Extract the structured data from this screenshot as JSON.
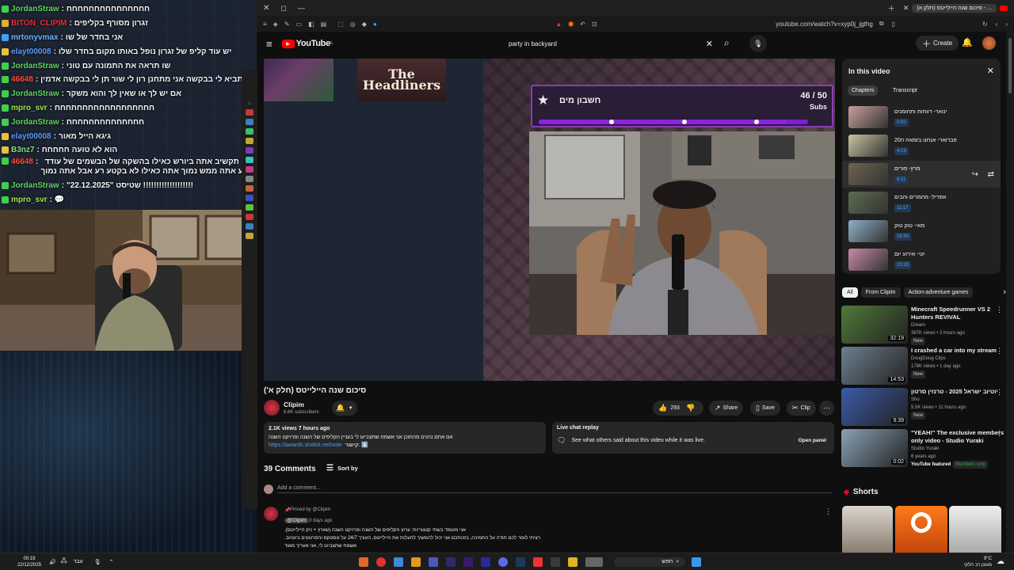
{
  "chat": {
    "messages": [
      {
        "user": "JordanStraw",
        "color": "#5fd35f",
        "badge": "#3fd14a",
        "text": "חחחחחחחחחחחחחחח"
      },
      {
        "user": "BITON_CLIPIM",
        "color": "#e0313a",
        "badge": "#e0b030",
        "text": "זגרון מסורף בקליפים"
      },
      {
        "user": "mrtonyvmax",
        "color": "#6ab6ff",
        "badge": "#3fa0ff",
        "text": "אני בחדר של שו"
      },
      {
        "user": "elayt00008",
        "color": "#5a9bff",
        "badge": "#e8c33a",
        "text": "יש עוד קליפ של זגרון נופל באותו מקום בחדר שלו"
      },
      {
        "user": "JordanStraw",
        "color": "#5fd35f",
        "badge": "#3fd14a",
        "text": "שו תראה את התמונה עם טוני"
      },
      {
        "user": "46648",
        "color": "#ff4c3b",
        "badge": "#3fd14a",
        "text": "שואו תביא לי בבקשה אני מתחנן רון לי שור תן לי בבקשה אדמין"
      },
      {
        "user": "JordanStraw",
        "color": "#5fd35f",
        "badge": "#3fd14a",
        "text": "אם יש לך או שאין לך והוא משקר"
      },
      {
        "user": "mpro_svr",
        "color": "#a0e34a",
        "badge": "#3fd14a",
        "text": "חחחחחחחחחחחחחחחחחח"
      },
      {
        "user": "JordanStraw",
        "color": "#5fd35f",
        "badge": "#3fd14a",
        "text": "חחחחחחחחחחחחחח"
      },
      {
        "user": "elayt00008",
        "color": "#5a9bff",
        "badge": "#e8c33a",
        "text": "גיגא הייל מאור"
      },
      {
        "user": "B3nz7",
        "color": "#7fe07f",
        "badge": "#e8c33a",
        "text": "הוא לא טועה חחחחח"
      },
      {
        "user": "46648",
        "color": "#ff4c3b",
        "badge": "#3fd14a",
        "text": "שוב תקשיב אתה ביורש כאילו בהשקה של הבשמים של עודד שמע אתה ממש נמוך אתה כאילו לא בקטע רע אבל אתה נמוך"
      },
      {
        "user": "JordanStraw",
        "color": "#5fd35f",
        "badge": "#3fd14a",
        "text": "\"22.12.2025\" שטיסט !!!!!!!!!!!!!!!!!!!"
      },
      {
        "user": "mpro_svr",
        "color": "#a0e34a",
        "badge": "#3fd14a",
        "text": "💬"
      }
    ]
  },
  "browser": {
    "url": "youtube.com/watch?v=xyp0j_jgthg",
    "tab_title": "סיכום שנה היילייטס (חלק א) - ..."
  },
  "youtube": {
    "logo": "YouTube",
    "country": "IL",
    "search_value": "party in backyard",
    "create_label": "Create",
    "video": {
      "overlay_title": "The Headliners",
      "goal_label": "חשבון מים",
      "goal_count": "46 / 50",
      "goal_unit": "Subs",
      "goal_progress": 0.92,
      "title": "סיכום שנה היילייטס (חלק א')"
    },
    "channel": {
      "name": "Clipim",
      "subs": "6.6K subscribers"
    },
    "actions": {
      "likes": "293",
      "share": "Share",
      "save": "Save",
      "clip": "Clip"
    },
    "description": {
      "meta": "2.1K views  7 hours ago",
      "line1": "אם אתם נהנים מהתוכן אני אשמח שתצביעו לי בעניין הקליפים של השנה ופרויקט השנה",
      "link": "https://awards.shotist.net/vote",
      "link_suffix": "קישור: ⬇️"
    },
    "live_chat": {
      "title": "Live chat replay",
      "text": "See what others said about this video while it was live.",
      "button": "Open panel"
    },
    "comments": {
      "count_label": "39 Comments",
      "sort_label": "Sort by",
      "placeholder": "Add a comment...",
      "pinned_label": "Pinned by @Clipim",
      "author": "@Clipim",
      "time": "3 days ago",
      "lines": [
        "אני מעומד בשתי קטגוריות: ערוץ הקליפים של השנה ופרויקט השנה (שוורץ + ניק היילייטס).",
        "רציתי לומר לכם תודה על התמיכה, בזכותכם אני יכול להמשיך להעלות את היילייטס, העורך 24/7 על טסטקס והסרטונים ביוטיוב.",
        "אשמח שתצביעו לי, אני אעריך מאוד"
      ]
    },
    "in_this_video": {
      "title": "In this video",
      "tabs": [
        "Chapters",
        "Transcript"
      ],
      "chapters": [
        {
          "title": "ינואר- דווחות ותהומנים",
          "time": "0:00",
          "color": "#c7a09b"
        },
        {
          "title": "פברואר- אנחנו בזמאה ה20",
          "time": "4:19",
          "color": "#c9c3a1"
        },
        {
          "title": "מרץ- פורים",
          "time": "8:11",
          "color": "#6f6450"
        },
        {
          "title": "אפריל- מהמרים והבים",
          "time": "11:17",
          "color": "#5d6c52"
        },
        {
          "title": "מאי- טוק טוק",
          "time": "16:50",
          "color": "#8fb0c8"
        },
        {
          "title": "יוני- אירוע יום",
          "time": "20:29",
          "color": "#c88aa6"
        }
      ]
    },
    "chips": [
      "All",
      "From Clipim",
      "Action-adventure games"
    ],
    "recommendations": [
      {
        "title": "Minecraft Speedrunner VS 2 Hunters REVIVAL",
        "channel": "Dream",
        "meta": "387K views • 2 hours ago",
        "badge": "New",
        "duration": "32:19",
        "color": "#4f7a3a"
      },
      {
        "title": "I crashed a car into my stream",
        "channel": "DougDoug Clips",
        "meta": "178K views • 1 day ago",
        "badge": "New",
        "duration": "14:53",
        "color": "#6d7f8f"
      },
      {
        "title": "יוטיוב ישראל 2025 - טרנזין סרטון",
        "channel": "Sho",
        "meta": "5.5K views • 11 hours ago",
        "badge": "New",
        "duration": "9:39",
        "color": "#3b5ba8"
      },
      {
        "title": "\"YEAH!\" The exclusive members only video - Studio Yuraki",
        "channel": "Studio Yuraki",
        "meta": "6 years ago",
        "badge": "YouTube featured",
        "badge2": "Members only",
        "duration": "0:02",
        "color": "#8aa1b5"
      }
    ],
    "shorts_label": "Shorts"
  },
  "taskbar": {
    "time": "00:19",
    "date": "22/12/2025",
    "lang": "עבר",
    "search": "חפש",
    "weather_temp": "9°C",
    "weather_text": "מעונן רב חלקי"
  }
}
